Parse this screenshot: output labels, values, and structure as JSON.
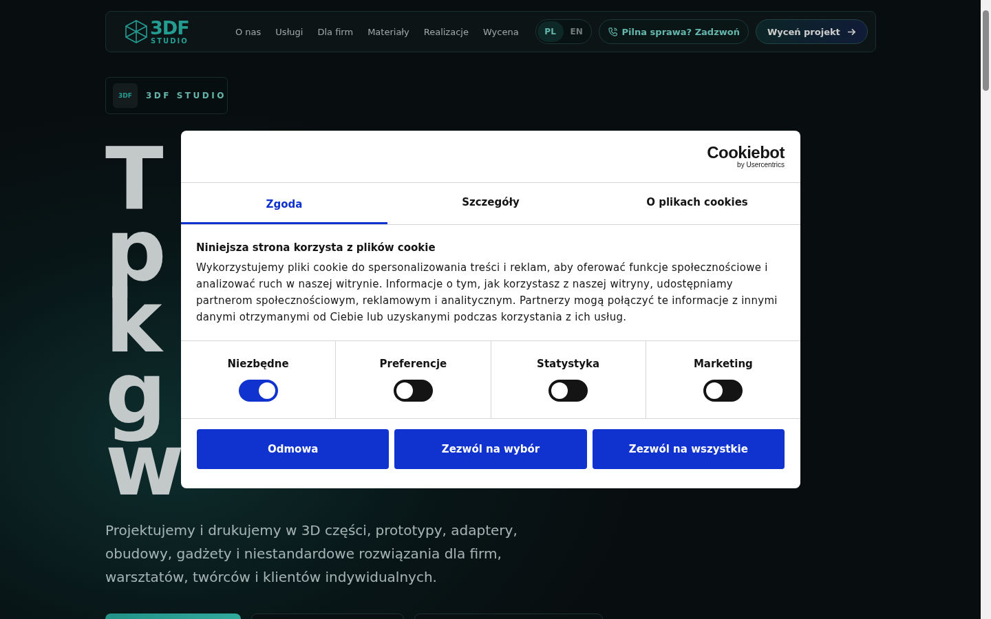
{
  "header": {
    "logo": {
      "mark": "3DF",
      "sub": "STUDIO"
    },
    "nav": [
      "O nas",
      "Usługi",
      "Dla firm",
      "Materiały",
      "Realizacje",
      "Wycena"
    ],
    "languages": [
      {
        "label": "PL",
        "selected": true
      },
      {
        "label": "EN",
        "selected": false
      }
    ],
    "call_button": "Pilna sprawa? Zadzwoń",
    "quote_button": "Wyceń projekt"
  },
  "hero": {
    "badge": {
      "mini_mark": "3DF",
      "label": "3DF STUDIO"
    },
    "heading_fragments": [
      "T",
      "p",
      "k",
      "g",
      "w"
    ],
    "lead": "Projektujemy i drukujemy w 3D części, prototypy, adaptery, obudowy, gadżety i niestandardowe rozwiązania dla firm, warsztatów, twórców i klientów indywidualnych.",
    "buttons": [
      {
        "kind": "primary"
      },
      {
        "kind": "outline"
      },
      {
        "kind": "outline"
      }
    ]
  },
  "cookie_dialog": {
    "brand": "Cookiebot",
    "brand_sub": "by Usercentrics",
    "tabs": [
      {
        "label": "Zgoda",
        "selected": true
      },
      {
        "label": "Szczegóły",
        "selected": false
      },
      {
        "label": "O plikach cookies",
        "selected": false
      }
    ],
    "title": "Niniejsza strona korzysta z plików cookie",
    "text": "Wykorzystujemy pliki cookie do spersonalizowania treści i reklam, aby oferować funkcje społecznościowe i analizować ruch w naszej witrynie. Informacje o tym, jak korzystasz z naszej witryny, udostępniamy partnerom społecznościowym, reklamowym i analitycznym. Partnerzy mogą połączyć te informacje z innymi danymi otrzymanymi od Ciebie lub uzyskanymi podczas korzystania z ich usług.",
    "categories": [
      {
        "label": "Niezbędne",
        "on": true
      },
      {
        "label": "Preferencje",
        "on": false
      },
      {
        "label": "Statystyka",
        "on": false
      },
      {
        "label": "Marketing",
        "on": false
      }
    ],
    "buttons": [
      "Odmowa",
      "Zezwól na wybór",
      "Zezwól na wszystkie"
    ]
  }
}
